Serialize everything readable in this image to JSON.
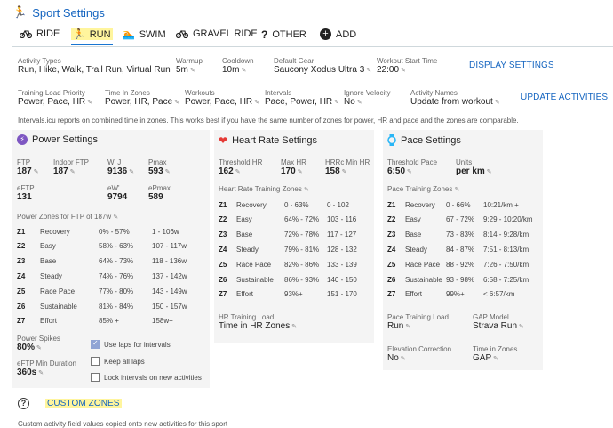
{
  "header": {
    "title": "Sport Settings"
  },
  "tabs": [
    {
      "label": "RIDE",
      "icon": "bike-icon"
    },
    {
      "label": "RUN",
      "icon": "run-icon",
      "active": true
    },
    {
      "label": "SWIM",
      "icon": "swim-icon"
    },
    {
      "label": "GRAVEL RIDE",
      "icon": "bike-icon"
    },
    {
      "label": "OTHER",
      "icon": "question-icon"
    },
    {
      "label": "ADD",
      "icon": "add-circle-icon"
    }
  ],
  "row1": {
    "activity_types": {
      "label": "Activity Types",
      "value": "Run, Hike, Walk, Trail Run, Virtual Run"
    },
    "warmup": {
      "label": "Warmup",
      "value": "5m"
    },
    "cooldown": {
      "label": "Cooldown",
      "value": "10m"
    },
    "default_gear": {
      "label": "Default Gear",
      "value": "Saucony Xodus Ultra 3"
    },
    "workout_start": {
      "label": "Workout Start Time",
      "value": "22:00"
    },
    "display_settings": "DISPLAY SETTINGS"
  },
  "row2": {
    "training_load": {
      "label": "Training Load Priority",
      "value": "Power, Pace, HR"
    },
    "time_in_zones": {
      "label": "Time In Zones",
      "value": "Power, HR, Pace"
    },
    "workouts": {
      "label": "Workouts",
      "value": "Power, Pace, HR"
    },
    "intervals": {
      "label": "Intervals",
      "value": "Pace, Power, HR"
    },
    "ignore_velocity": {
      "label": "Ignore Velocity",
      "value": "No"
    },
    "activity_names": {
      "label": "Activity Names",
      "value": "Update from workout"
    },
    "update_activities": "UPDATE ACTIVITIES"
  },
  "info_note": "Intervals.icu reports on combined time in zones. This works best if you have the same number of zones for power, HR and pace and the zones are comparable.",
  "power": {
    "title": "Power Settings",
    "ftp": {
      "label": "FTP",
      "value": "187"
    },
    "indoor_ftp": {
      "label": "Indoor FTP",
      "value": "187"
    },
    "wj": {
      "label": "W' J",
      "value": "9136"
    },
    "pmax": {
      "label": "Pmax",
      "value": "593"
    },
    "eftp": {
      "label": "eFTP",
      "value": "131"
    },
    "ew": {
      "label": "eW'",
      "value": "9794"
    },
    "epmax": {
      "label": "ePmax",
      "value": "589"
    },
    "zones_title": "Power Zones for FTP of 187w",
    "zones": [
      {
        "z": "Z1",
        "name": "Recovery",
        "pct": "0% - 57%",
        "range": "1 - 106w"
      },
      {
        "z": "Z2",
        "name": "Easy",
        "pct": "58% - 63%",
        "range": "107 - 117w"
      },
      {
        "z": "Z3",
        "name": "Base",
        "pct": "64% - 73%",
        "range": "118 - 136w"
      },
      {
        "z": "Z4",
        "name": "Steady",
        "pct": "74% - 76%",
        "range": "137 - 142w"
      },
      {
        "z": "Z5",
        "name": "Race Pace",
        "pct": "77% - 80%",
        "range": "143 - 149w"
      },
      {
        "z": "Z6",
        "name": "Sustainable",
        "pct": "81% - 84%",
        "range": "150 - 157w"
      },
      {
        "z": "Z7",
        "name": "Effort",
        "pct": "85% +",
        "range": "158w+"
      }
    ],
    "power_spikes": {
      "label": "Power Spikes",
      "value": "80%"
    },
    "eftp_min_duration": {
      "label": "eFTP Min Duration",
      "value": "360s"
    },
    "checkboxes": [
      {
        "label": "Use laps for intervals",
        "checked": true
      },
      {
        "label": "Keep all laps",
        "checked": false
      },
      {
        "label": "Lock intervals on new activities",
        "checked": false
      }
    ]
  },
  "hr": {
    "title": "Heart Rate Settings",
    "threshold": {
      "label": "Threshold HR",
      "value": "162"
    },
    "max": {
      "label": "Max HR",
      "value": "170"
    },
    "hrrc": {
      "label": "HRRc Min HR",
      "value": "158"
    },
    "zones_title": "Heart Rate Training Zones",
    "zones": [
      {
        "z": "Z1",
        "name": "Recovery",
        "pct": "0 - 63%",
        "range": "0 - 102"
      },
      {
        "z": "Z2",
        "name": "Easy",
        "pct": "64% - 72%",
        "range": "103 - 116"
      },
      {
        "z": "Z3",
        "name": "Base",
        "pct": "72% - 78%",
        "range": "117 - 127"
      },
      {
        "z": "Z4",
        "name": "Steady",
        "pct": "79% - 81%",
        "range": "128 - 132"
      },
      {
        "z": "Z5",
        "name": "Race Pace",
        "pct": "82% - 86%",
        "range": "133 - 139"
      },
      {
        "z": "Z6",
        "name": "Sustainable",
        "pct": "86% - 93%",
        "range": "140 - 150"
      },
      {
        "z": "Z7",
        "name": "Effort",
        "pct": "93%+",
        "range": "151 - 170"
      }
    ],
    "training_load": {
      "label": "HR Training Load",
      "value": "Time in HR Zones"
    }
  },
  "pace": {
    "title": "Pace Settings",
    "threshold": {
      "label": "Threshold Pace",
      "value": "6:50"
    },
    "units": {
      "label": "Units",
      "value": "per km"
    },
    "zones_title": "Pace Training Zones",
    "zones": [
      {
        "z": "Z1",
        "name": "Recovery",
        "pct": "0 - 66%",
        "range": "10:21/km +"
      },
      {
        "z": "Z2",
        "name": "Easy",
        "pct": "67 - 72%",
        "range": "9:29 - 10:20/km"
      },
      {
        "z": "Z3",
        "name": "Base",
        "pct": "73 - 83%",
        "range": "8:14 - 9:28/km"
      },
      {
        "z": "Z4",
        "name": "Steady",
        "pct": "84 - 87%",
        "range": "7:51 - 8:13/km"
      },
      {
        "z": "Z5",
        "name": "Race Pace",
        "pct": "88 - 92%",
        "range": "7:26 - 7:50/km"
      },
      {
        "z": "Z6",
        "name": "Sustainable",
        "pct": "93 - 98%",
        "range": "6:58 - 7:25/km"
      },
      {
        "z": "Z7",
        "name": "Effort",
        "pct": "99%+",
        "range": "< 6:57/km"
      }
    ],
    "training_load": {
      "label": "Pace Training Load",
      "value": "Run"
    },
    "gap_model": {
      "label": "GAP Model",
      "value": "Strava Run"
    },
    "elevation": {
      "label": "Elevation Correction",
      "value": "No"
    },
    "time_in_zones": {
      "label": "Time in Zones",
      "value": "GAP"
    }
  },
  "custom_zones": {
    "label": "CUSTOM ZONES"
  },
  "footer_note": "Custom activity field values copied onto new activities for this sport",
  "colors": {
    "accent": "#1565c0",
    "highlight": "#fff59d",
    "panel": "#f4f4f4",
    "heart": "#e53935",
    "bolt": "#7e57c2",
    "watch": "#29b6f6"
  }
}
